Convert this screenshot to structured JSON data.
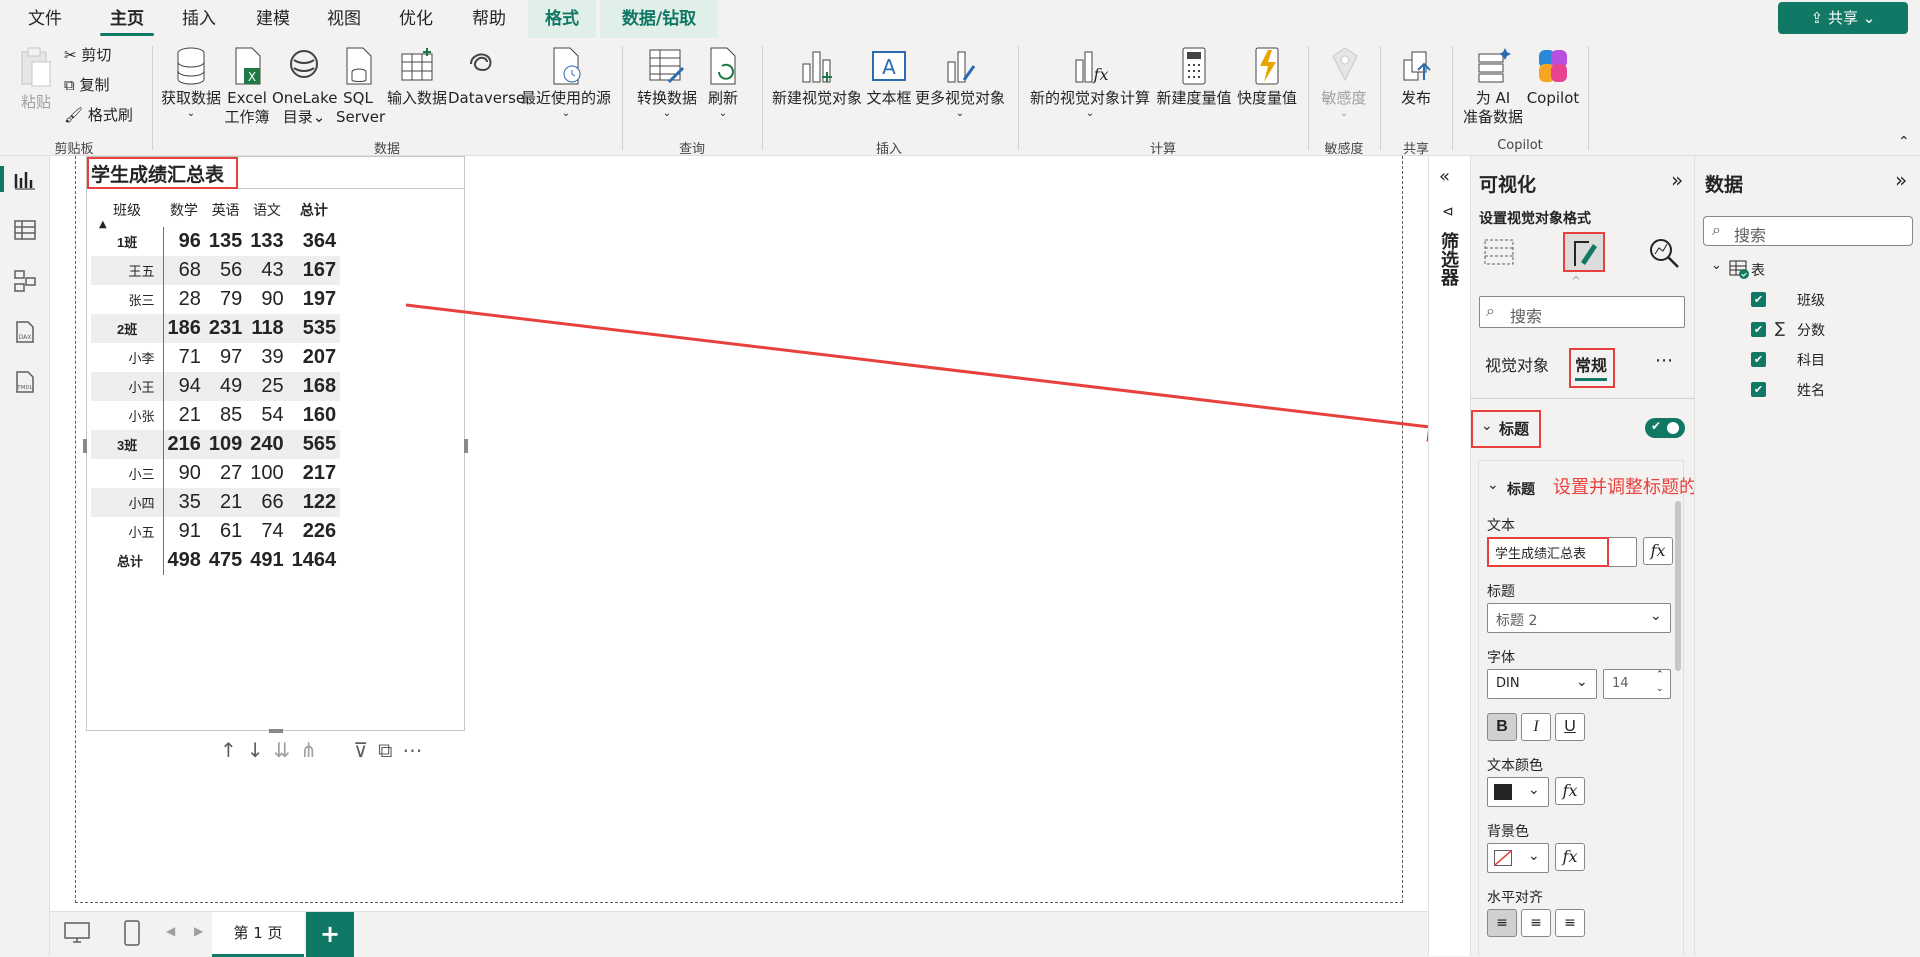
{
  "menu": {
    "tabs": [
      "文件",
      "主页",
      "插入",
      "建模",
      "视图",
      "优化",
      "帮助",
      "格式",
      "数据/钻取"
    ],
    "share": "共享"
  },
  "ribbon": {
    "paste": "粘贴",
    "cut": "剪切",
    "copy": "复制",
    "format_painter": "格式刷",
    "clipboard_group": "剪贴板",
    "get_data": "获取数据",
    "excel1": "Excel",
    "excel2": "工作簿",
    "onelake1": "OneLake",
    "onelake2": "目录",
    "sql1": "SQL",
    "sql2": "Server",
    "enter_data": "输入数据",
    "dataverse": "Dataverse",
    "recent": "最近使用的源",
    "data_group": "数据",
    "transform": "转换数据",
    "refresh": "刷新",
    "query_group": "查询",
    "new_visual": "新建视觉对象",
    "textbox": "文本框",
    "more_visuals": "更多视觉对象",
    "insert_group": "插入",
    "new_visual_calc": "新的视觉对象计算",
    "new_measure": "新建度量值",
    "quick_measure": "快度量值",
    "calc_group": "计算",
    "sensitivity": "敏感度",
    "sensitivity_group": "敏感度",
    "publish": "发布",
    "share_group": "共享",
    "ai1": "为 AI",
    "ai2": "准备数据",
    "copilot": "Copilot",
    "copilot_group": "Copilot"
  },
  "visual": {
    "title": "学生成绩汇总表",
    "headers": [
      "班级",
      "数学",
      "英语",
      "语文",
      "总计"
    ],
    "rows": [
      {
        "label": "1班",
        "values": [
          "96",
          "135",
          "133",
          "364"
        ],
        "subtotal": true
      },
      {
        "label": "王五",
        "values": [
          "68",
          "56",
          "43",
          "167"
        ],
        "subtotal": false
      },
      {
        "label": "张三",
        "values": [
          "28",
          "79",
          "90",
          "197"
        ],
        "subtotal": false
      },
      {
        "label": "2班",
        "values": [
          "186",
          "231",
          "118",
          "535"
        ],
        "subtotal": true
      },
      {
        "label": "小李",
        "values": [
          "71",
          "97",
          "39",
          "207"
        ],
        "subtotal": false
      },
      {
        "label": "小王",
        "values": [
          "94",
          "49",
          "25",
          "168"
        ],
        "subtotal": false
      },
      {
        "label": "小张",
        "values": [
          "21",
          "85",
          "54",
          "160"
        ],
        "subtotal": false
      },
      {
        "label": "3班",
        "values": [
          "216",
          "109",
          "240",
          "565"
        ],
        "subtotal": true
      },
      {
        "label": "小三",
        "values": [
          "90",
          "27",
          "100",
          "217"
        ],
        "subtotal": false
      },
      {
        "label": "小四",
        "values": [
          "35",
          "21",
          "66",
          "122"
        ],
        "subtotal": false
      },
      {
        "label": "小五",
        "values": [
          "91",
          "61",
          "74",
          "226"
        ],
        "subtotal": false
      },
      {
        "label": "总计",
        "values": [
          "498",
          "475",
          "491",
          "1464"
        ],
        "subtotal": true
      }
    ]
  },
  "filters_label": "筛选器",
  "viz_pane": {
    "title": "可视化",
    "subtitle": "设置视觉对象格式",
    "search_placeholder": "搜索",
    "tab_visual": "视觉对象",
    "tab_general": "常规",
    "section_title": "标题",
    "sub_title": "标题",
    "annotation": "设置并调整标题的相关参数",
    "text_label": "文本",
    "text_value": "学生成绩汇总表",
    "heading_label": "标题",
    "heading_value": "标题 2",
    "font_label": "字体",
    "font_value": "DIN",
    "font_size": "14",
    "text_color_label": "文本颜色",
    "bg_color_label": "背景色",
    "halign_label": "水平对齐"
  },
  "data_pane": {
    "title": "数据",
    "search_placeholder": "搜索",
    "table_name": "表",
    "fields": [
      "班级",
      "分数",
      "科目",
      "姓名"
    ]
  },
  "bottom": {
    "page_tab": "第 1 页",
    "add": "+"
  },
  "colors": {
    "accent": "#117865",
    "annotation": "#e8413d",
    "selection": "#4f6bed"
  }
}
